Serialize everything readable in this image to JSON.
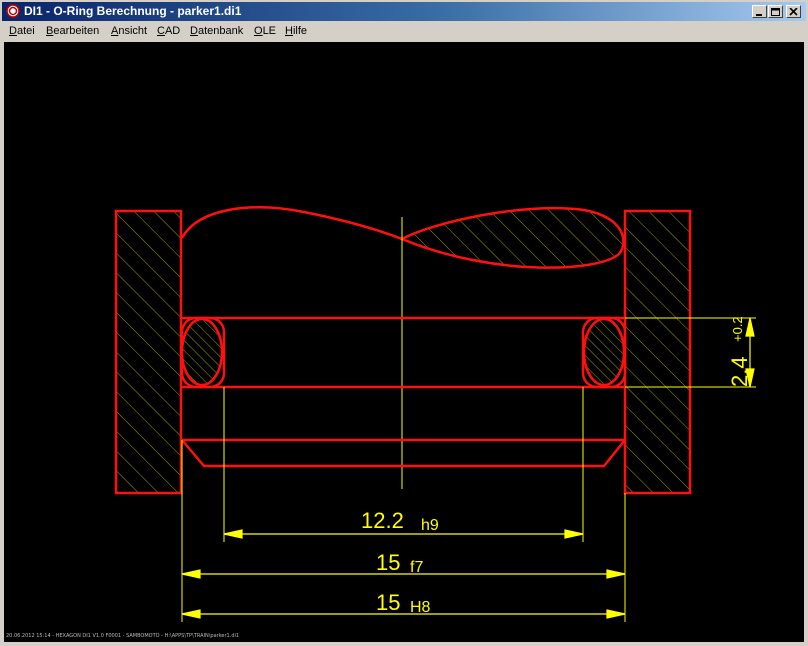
{
  "window": {
    "title": "DI1 - O-Ring Berechnung  -  parker1.di1"
  },
  "menu": {
    "items": [
      {
        "label": "Datei",
        "ul": "D",
        "rest": "atei"
      },
      {
        "label": "Bearbeiten",
        "ul": "B",
        "rest": "earbeiten"
      },
      {
        "label": "Ansicht",
        "ul": "A",
        "rest": "nsicht"
      },
      {
        "label": "CAD",
        "ul": "C",
        "rest": "AD"
      },
      {
        "label": "Datenbank",
        "ul": "D",
        "rest": "atenbank"
      },
      {
        "label": "OLE",
        "ul": "O",
        "rest": "LE"
      },
      {
        "label": "Hilfe",
        "ul": "H",
        "rest": "ilfe"
      }
    ]
  },
  "drawing": {
    "dim_groove_width": {
      "value": "2.4",
      "tol_upper": "+0.2"
    },
    "dim_inner": {
      "value": "12.2",
      "fit": "h9"
    },
    "dim_middle": {
      "value": "15",
      "fit": "f7"
    },
    "dim_outer": {
      "value": "15",
      "fit": "H8"
    },
    "colors": {
      "outline": "#ff1010",
      "dimension": "#ffff00",
      "hatch": "#c8c800",
      "background": "#000000"
    }
  },
  "status": {
    "text": "20.06.2012 15:14 - HEXAGON DI1 V1.0 F0001 - SAMBOMOTO - H:\\APPS\\TP\\TRAIN\\parker1.di1"
  }
}
